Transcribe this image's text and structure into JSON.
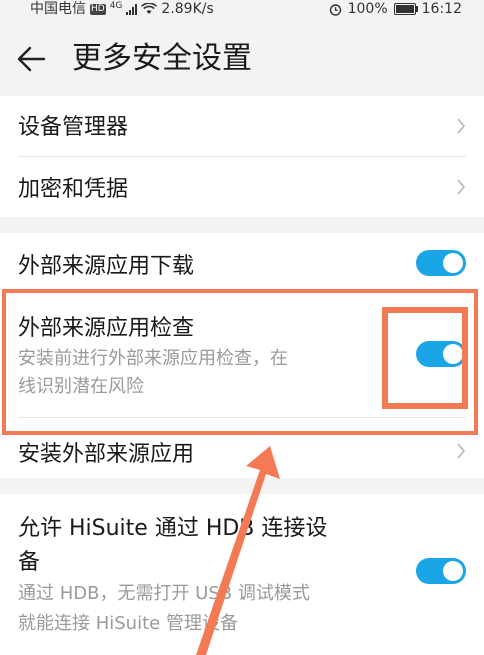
{
  "status_bar": {
    "carrier": "中国电信",
    "hd_badge": "HD",
    "network_type": "4G",
    "speed": "2.89K/s",
    "battery_percent": "100%",
    "time": "16:12"
  },
  "header": {
    "title": "更多安全设置"
  },
  "items": {
    "device_manager": {
      "title": "设备管理器"
    },
    "encryption": {
      "title": "加密和凭据"
    },
    "external_download": {
      "title": "外部来源应用下载",
      "enabled": true
    },
    "external_check": {
      "title": "外部来源应用检查",
      "desc_line1": "安装前进行外部来源应用检查，在",
      "desc_line2": "线识别潜在风险",
      "enabled": true
    },
    "install_external": {
      "title": "安装外部来源应用"
    },
    "hisuite": {
      "title_line1": "允许 HiSuite 通过 HDB 连接设",
      "title_line2": "备",
      "desc_line1": "通过 HDB，无需打开 USB 调试模式",
      "desc_line2": "就能连接 HiSuite 管理设备",
      "enabled": true
    }
  },
  "colors": {
    "toggle_on": "#1aa5e6",
    "annotation": "#f47a56",
    "section_gap": "#f3f3f3"
  }
}
